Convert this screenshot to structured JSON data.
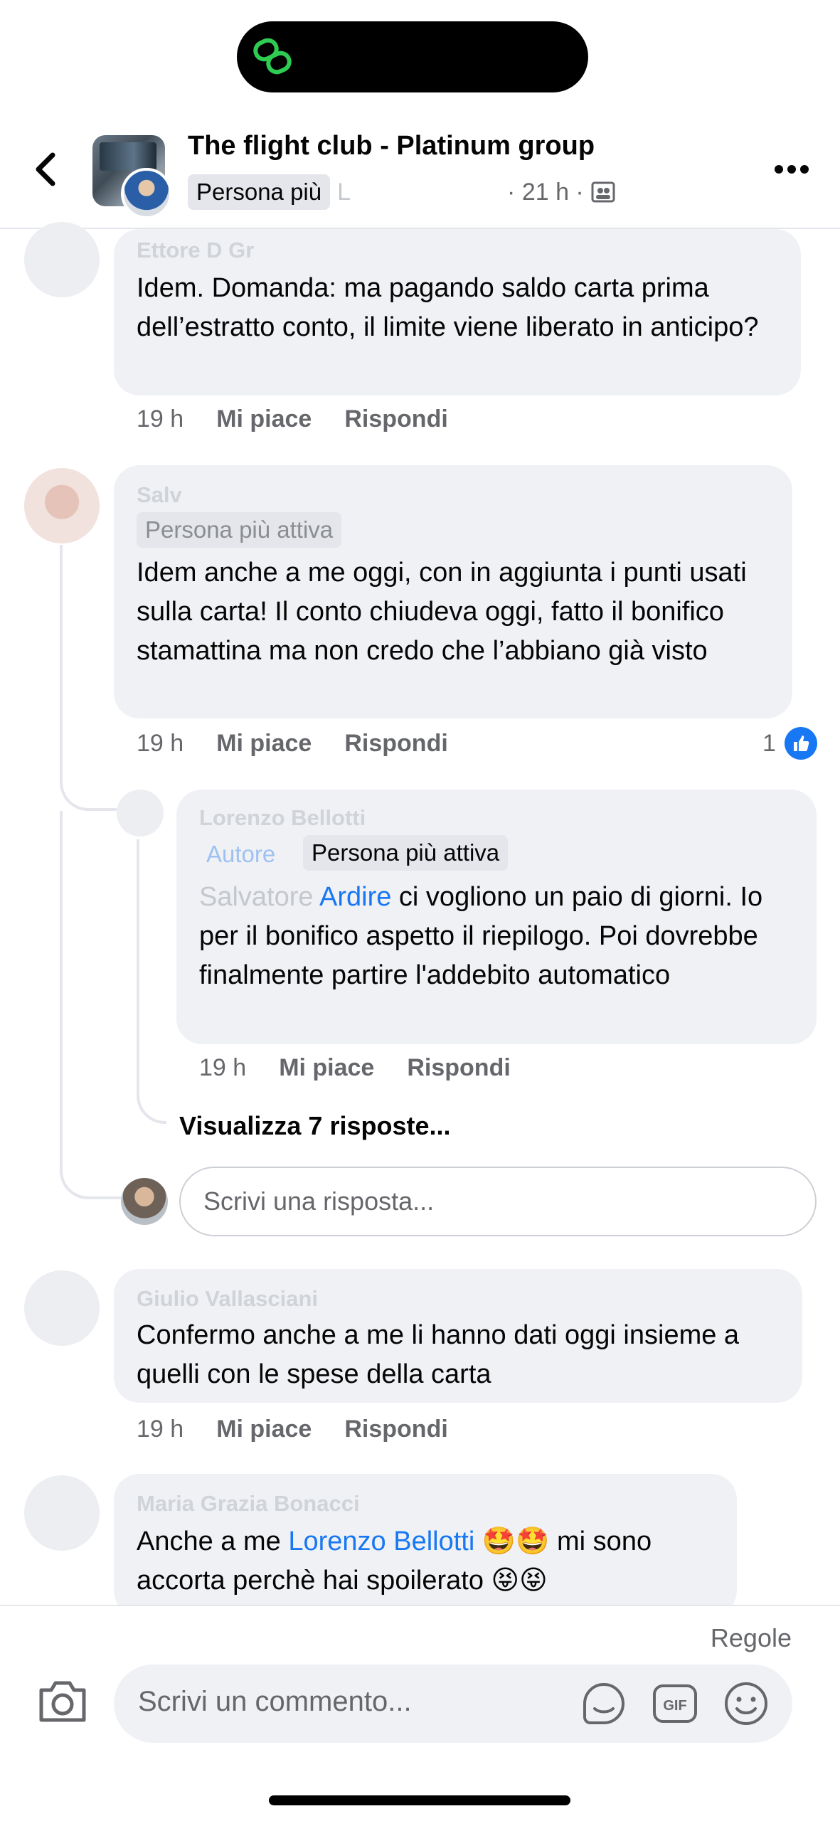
{
  "header": {
    "group_title": "The flight club - Platinum group",
    "badge": "Persona più",
    "author_partial": "L",
    "time": "· 21 h ·",
    "icons": {
      "back": "chevron-left-icon",
      "more": "more-horizontal-icon",
      "privacy": "group-members-icon"
    }
  },
  "comments": [
    {
      "author": "Ettore D Gr",
      "text": "Idem.  Domanda: ma pagando saldo carta prima dell’estratto conto, il limite viene liberato in anticipo?",
      "time": "19 h",
      "like_label": "Mi piace",
      "reply_label": "Rispondi"
    },
    {
      "author": "Salv",
      "badge": "Persona più attiva",
      "text": "Idem anche a me oggi, con in aggiunta i punti usati sulla carta! Il conto chiudeva oggi, fatto il bonifico stamattina ma non credo che l’abbiano già visto",
      "time": "19 h",
      "like_label": "Mi piace",
      "reply_label": "Rispondi",
      "reactions": "1",
      "reply": {
        "author": "Lorenzo Bellotti",
        "author_badge": "Autore",
        "badge": "Persona più attiva",
        "mention_prefix": "Salvatore ",
        "mention": "Ardire",
        "text_after": " ci vogliono un paio di giorni. Io per il bonifico aspetto il riepilogo. Poi dovrebbe finalmente partire l'addebito automatico",
        "time": "19 h",
        "like_label": "Mi piace",
        "reply_label": "Rispondi"
      },
      "view_replies": "Visualizza 7 risposte...",
      "reply_placeholder": "Scrivi una risposta..."
    },
    {
      "author": "Giulio Vallasciani",
      "text": "Confermo anche a me li hanno dati oggi insieme a quelli con le spese della carta",
      "time": "19 h",
      "like_label": "Mi piace",
      "reply_label": "Rispondi"
    },
    {
      "author": "Maria Grazia Bonacci",
      "text_before": "Anche a me ",
      "mention": "Lorenzo Bellotti",
      "text_after": " 🤩🤩 mi sono accorta perchè hai spoilerato 😝😝"
    }
  ],
  "footer": {
    "rules": "Regole",
    "placeholder": "Scrivi un commento...",
    "icons": [
      "camera-icon",
      "sticker-icon",
      "gif-icon",
      "emoji-icon"
    ]
  },
  "colors": {
    "accent": "#1877f2",
    "bubble": "#eff1f4",
    "muted": "#65676b"
  }
}
